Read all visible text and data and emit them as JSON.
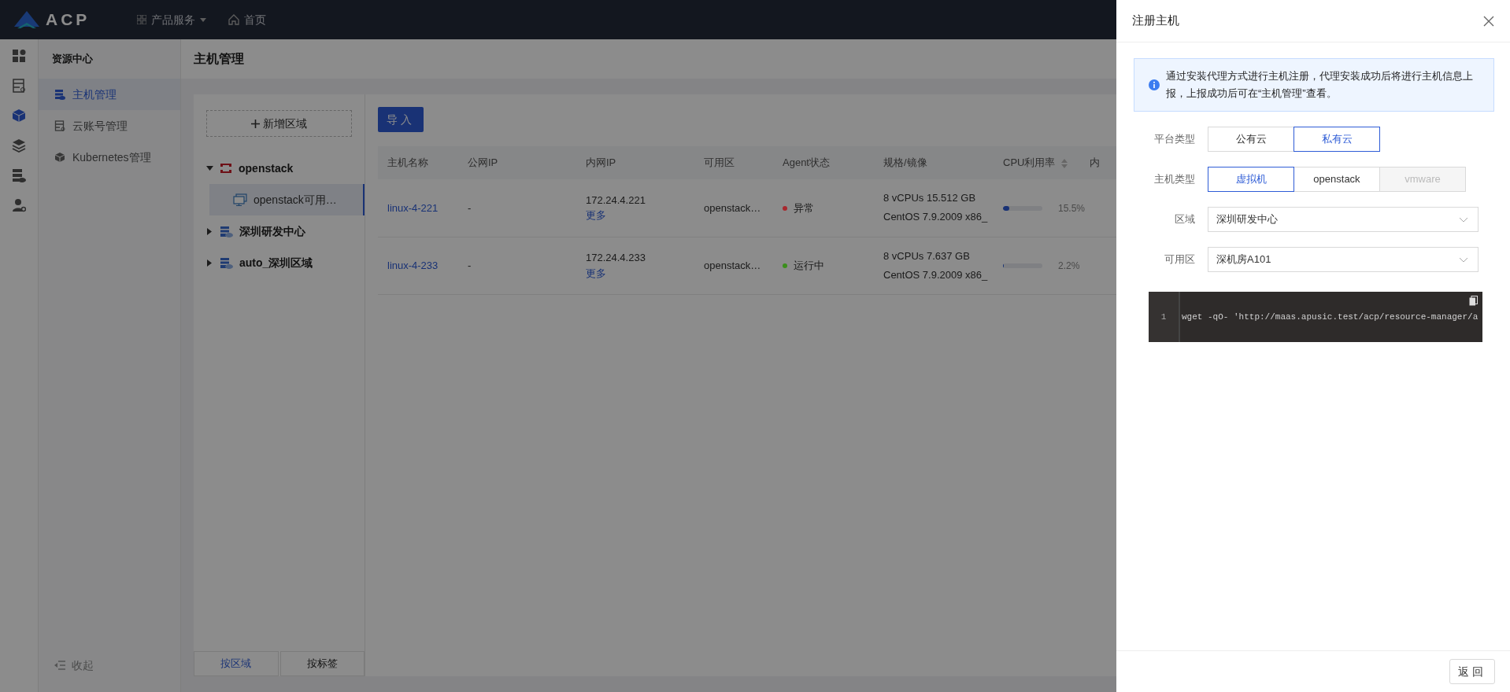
{
  "topbar": {
    "logo": "ACP",
    "menu": [
      {
        "label": "产品服务",
        "kind": "dropdown"
      },
      {
        "label": "首页",
        "kind": "home"
      }
    ]
  },
  "rail": [
    {
      "selected": false
    },
    {
      "selected": false
    },
    {
      "selected": true
    },
    {
      "selected": false
    },
    {
      "selected": false
    },
    {
      "selected": false
    }
  ],
  "sidebar": {
    "title": "资源中心",
    "items": [
      {
        "label": "主机管理",
        "selected": true
      },
      {
        "label": "云账号管理",
        "selected": false
      },
      {
        "label": "Kubernetes管理",
        "selected": false
      }
    ],
    "collapse": "收起"
  },
  "page_title": "主机管理",
  "tree": {
    "add_button": "新增区域",
    "nodes": [
      {
        "label": "openstack",
        "kind": "openstack",
        "expanded": true,
        "children": [
          {
            "label": "openstack可用…",
            "kind": "zone",
            "selected": true
          }
        ]
      },
      {
        "label": "深圳研发中心",
        "kind": "region",
        "expanded": false
      },
      {
        "label": "auto_深圳区域",
        "kind": "region",
        "expanded": false
      }
    ],
    "tabs": [
      {
        "label": "按区域",
        "selected": true
      },
      {
        "label": "按标签",
        "selected": false
      }
    ]
  },
  "import_button": "导入",
  "table": {
    "columns": [
      {
        "label": "主机名称",
        "sortable": false
      },
      {
        "label": "公网IP",
        "sortable": false
      },
      {
        "label": "内网IP",
        "sortable": false
      },
      {
        "label": "可用区",
        "sortable": false
      },
      {
        "label": "Agent状态",
        "sortable": false
      },
      {
        "label": "规格/镜像",
        "sortable": false
      },
      {
        "label": "CPU利用率",
        "sortable": true
      },
      {
        "label": "内",
        "sortable": false
      }
    ],
    "rows": [
      {
        "name": "linux-4-221",
        "public_ip": "-",
        "private_ip": "172.24.4.221",
        "more": "更多",
        "zone": "openstack…",
        "agent": {
          "label": "异常",
          "color": "#a8282e"
        },
        "spec": "8 vCPUs 15.512 GB",
        "image": "CentOS 7.9.2009 x86_",
        "cpu": {
          "level": 0.155,
          "reading": "15.5%"
        }
      },
      {
        "name": "linux-4-233",
        "public_ip": "-",
        "private_ip": "172.24.4.233",
        "more": "更多",
        "zone": "openstack…",
        "agent": {
          "label": "运行中",
          "color": "#3b8f1c"
        },
        "spec": "8 vCPUs 7.637 GB",
        "image": "CentOS 7.9.2009 x86_",
        "cpu": {
          "level": 0.022,
          "reading": "2.2%"
        }
      }
    ]
  },
  "drawer": {
    "title": "注册主机",
    "alert": "通过安装代理方式进行主机注册，代理安装成功后将进行主机信息上报，上报成功后可在“主机管理”查看。",
    "fields": [
      {
        "label": "平台类型",
        "kind": "segmented",
        "options": [
          {
            "label": "公有云",
            "selected": false,
            "disabled": false
          },
          {
            "label": "私有云",
            "selected": true,
            "disabled": false
          }
        ]
      },
      {
        "label": "主机类型",
        "kind": "segmented",
        "options": [
          {
            "label": "虚拟机",
            "selected": true,
            "disabled": false
          },
          {
            "label": "openstack",
            "selected": false,
            "disabled": false
          },
          {
            "label": "vmware",
            "selected": false,
            "disabled": true
          }
        ]
      },
      {
        "label": "区域",
        "kind": "select",
        "value": "深圳研发中心"
      },
      {
        "label": "可用区",
        "kind": "select",
        "value": "深机房A101"
      }
    ],
    "code": [
      {
        "number": "1",
        "text": "wget -qO- 'http://maas.apusic.test/acp/resource-manager/a"
      }
    ],
    "back_button": "返回"
  }
}
